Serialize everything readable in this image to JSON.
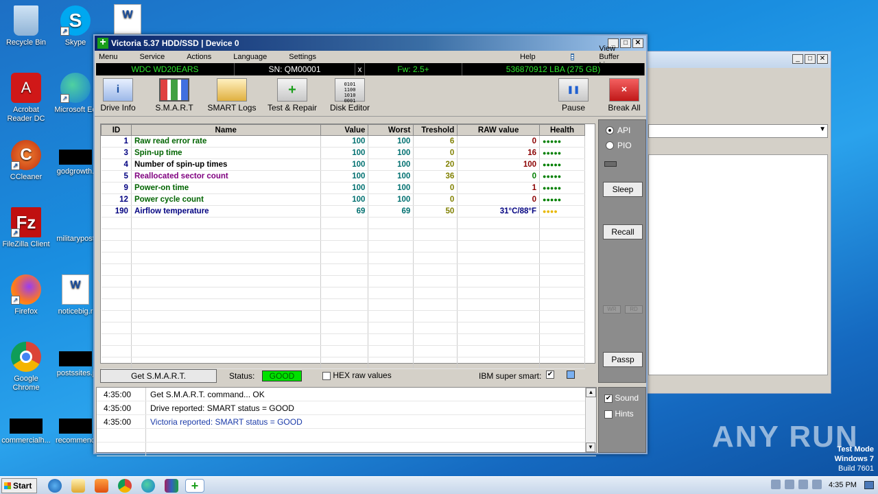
{
  "desktop": {
    "icons": [
      {
        "label": "Recycle Bin"
      },
      {
        "label": "Skype"
      },
      {
        "label": "Acrobat Reader DC"
      },
      {
        "label": "Microsoft Ed"
      },
      {
        "label": "CCleaner"
      },
      {
        "label": "godgrowth."
      },
      {
        "label": "FileZilla Client"
      },
      {
        "label": "militarypost"
      },
      {
        "label": "Firefox"
      },
      {
        "label": "noticebig.r"
      },
      {
        "label": "Google Chrome"
      },
      {
        "label": "postssites.j"
      },
      {
        "label": "commercialh..."
      },
      {
        "label": "recommend"
      }
    ]
  },
  "window": {
    "title": "Victoria 5.37 HDD/SSD | Device 0",
    "menu": [
      "Menu",
      "Service",
      "Actions",
      "Language",
      "Settings"
    ],
    "help": "Help",
    "view_buffer": "View Buffer Live"
  },
  "drive": {
    "model": "WDC WD20EARS",
    "serial": "SN: QM00001",
    "close": "x",
    "firmware": "Fw: 2.5+",
    "capacity": "536870912 LBA (275 GB)"
  },
  "toolbar": {
    "drive_info": "Drive Info",
    "smart": "S.M.A.R.T",
    "smart_logs": "SMART Logs",
    "test_repair": "Test & Repair",
    "disk_editor": "Disk Editor",
    "pause": "Pause",
    "break_all": "Break All"
  },
  "smart_table": {
    "headers": [
      "ID",
      "Name",
      "Value",
      "Worst",
      "Treshold",
      "RAW value",
      "Health"
    ],
    "rows": [
      {
        "id": "1",
        "name": "Raw read error rate",
        "value": "100",
        "worst": "100",
        "threshold": "6",
        "raw": "0",
        "health": "●●●●●"
      },
      {
        "id": "3",
        "name": "Spin-up time",
        "value": "100",
        "worst": "100",
        "threshold": "0",
        "raw": "16",
        "health": "●●●●●"
      },
      {
        "id": "4",
        "name": "Number of spin-up times",
        "value": "100",
        "worst": "100",
        "threshold": "20",
        "raw": "100",
        "health": "●●●●●"
      },
      {
        "id": "5",
        "name": "Reallocated sector count",
        "value": "100",
        "worst": "100",
        "threshold": "36",
        "raw": "0",
        "health": "●●●●●"
      },
      {
        "id": "9",
        "name": "Power-on time",
        "value": "100",
        "worst": "100",
        "threshold": "0",
        "raw": "1",
        "health": "●●●●●"
      },
      {
        "id": "12",
        "name": "Power cycle count",
        "value": "100",
        "worst": "100",
        "threshold": "0",
        "raw": "0",
        "health": "●●●●●"
      },
      {
        "id": "190",
        "name": "Airflow temperature",
        "value": "69",
        "worst": "69",
        "threshold": "50",
        "raw": "31°C/88°F",
        "health": "●●●●"
      }
    ]
  },
  "side": {
    "api": "API",
    "pio": "PIO",
    "sleep": "Sleep",
    "recall": "Recall",
    "wr": "WR",
    "rd": "RD",
    "passp": "Passp"
  },
  "status_bar": {
    "get_smart": "Get S.M.A.R.T.",
    "status_label": "Status:",
    "status_value": "GOOD",
    "hex_raw": "HEX raw values",
    "ibm_super_smart": "IBM super smart:",
    "ibm_checked": "✔"
  },
  "log": [
    {
      "time": "4:35:00",
      "msg": "Get S.M.A.R.T. command... OK"
    },
    {
      "time": "4:35:00",
      "msg": "Drive reported: SMART status = GOOD"
    },
    {
      "time": "4:35:00",
      "msg": "Victoria reported: SMART status = GOOD"
    }
  ],
  "log_side": {
    "sound": "Sound",
    "sound_checked": "✔",
    "hints": "Hints"
  },
  "taskbar": {
    "start": "Start",
    "clock": "4:35 PM"
  },
  "watermark": "ANY RUN",
  "test_mode": {
    "line1": "Test Mode",
    "line2": "Windows 7",
    "line3": "Build 7601"
  },
  "colors": {
    "green_name": "#006400",
    "purple_name": "#800080",
    "blue_name": "#000080",
    "raw_red": "#8b0000",
    "teal": "#007070",
    "olive": "#808000",
    "health_green": "#008000",
    "health_yellow": "#e8b800",
    "status_good": "#00e000"
  }
}
